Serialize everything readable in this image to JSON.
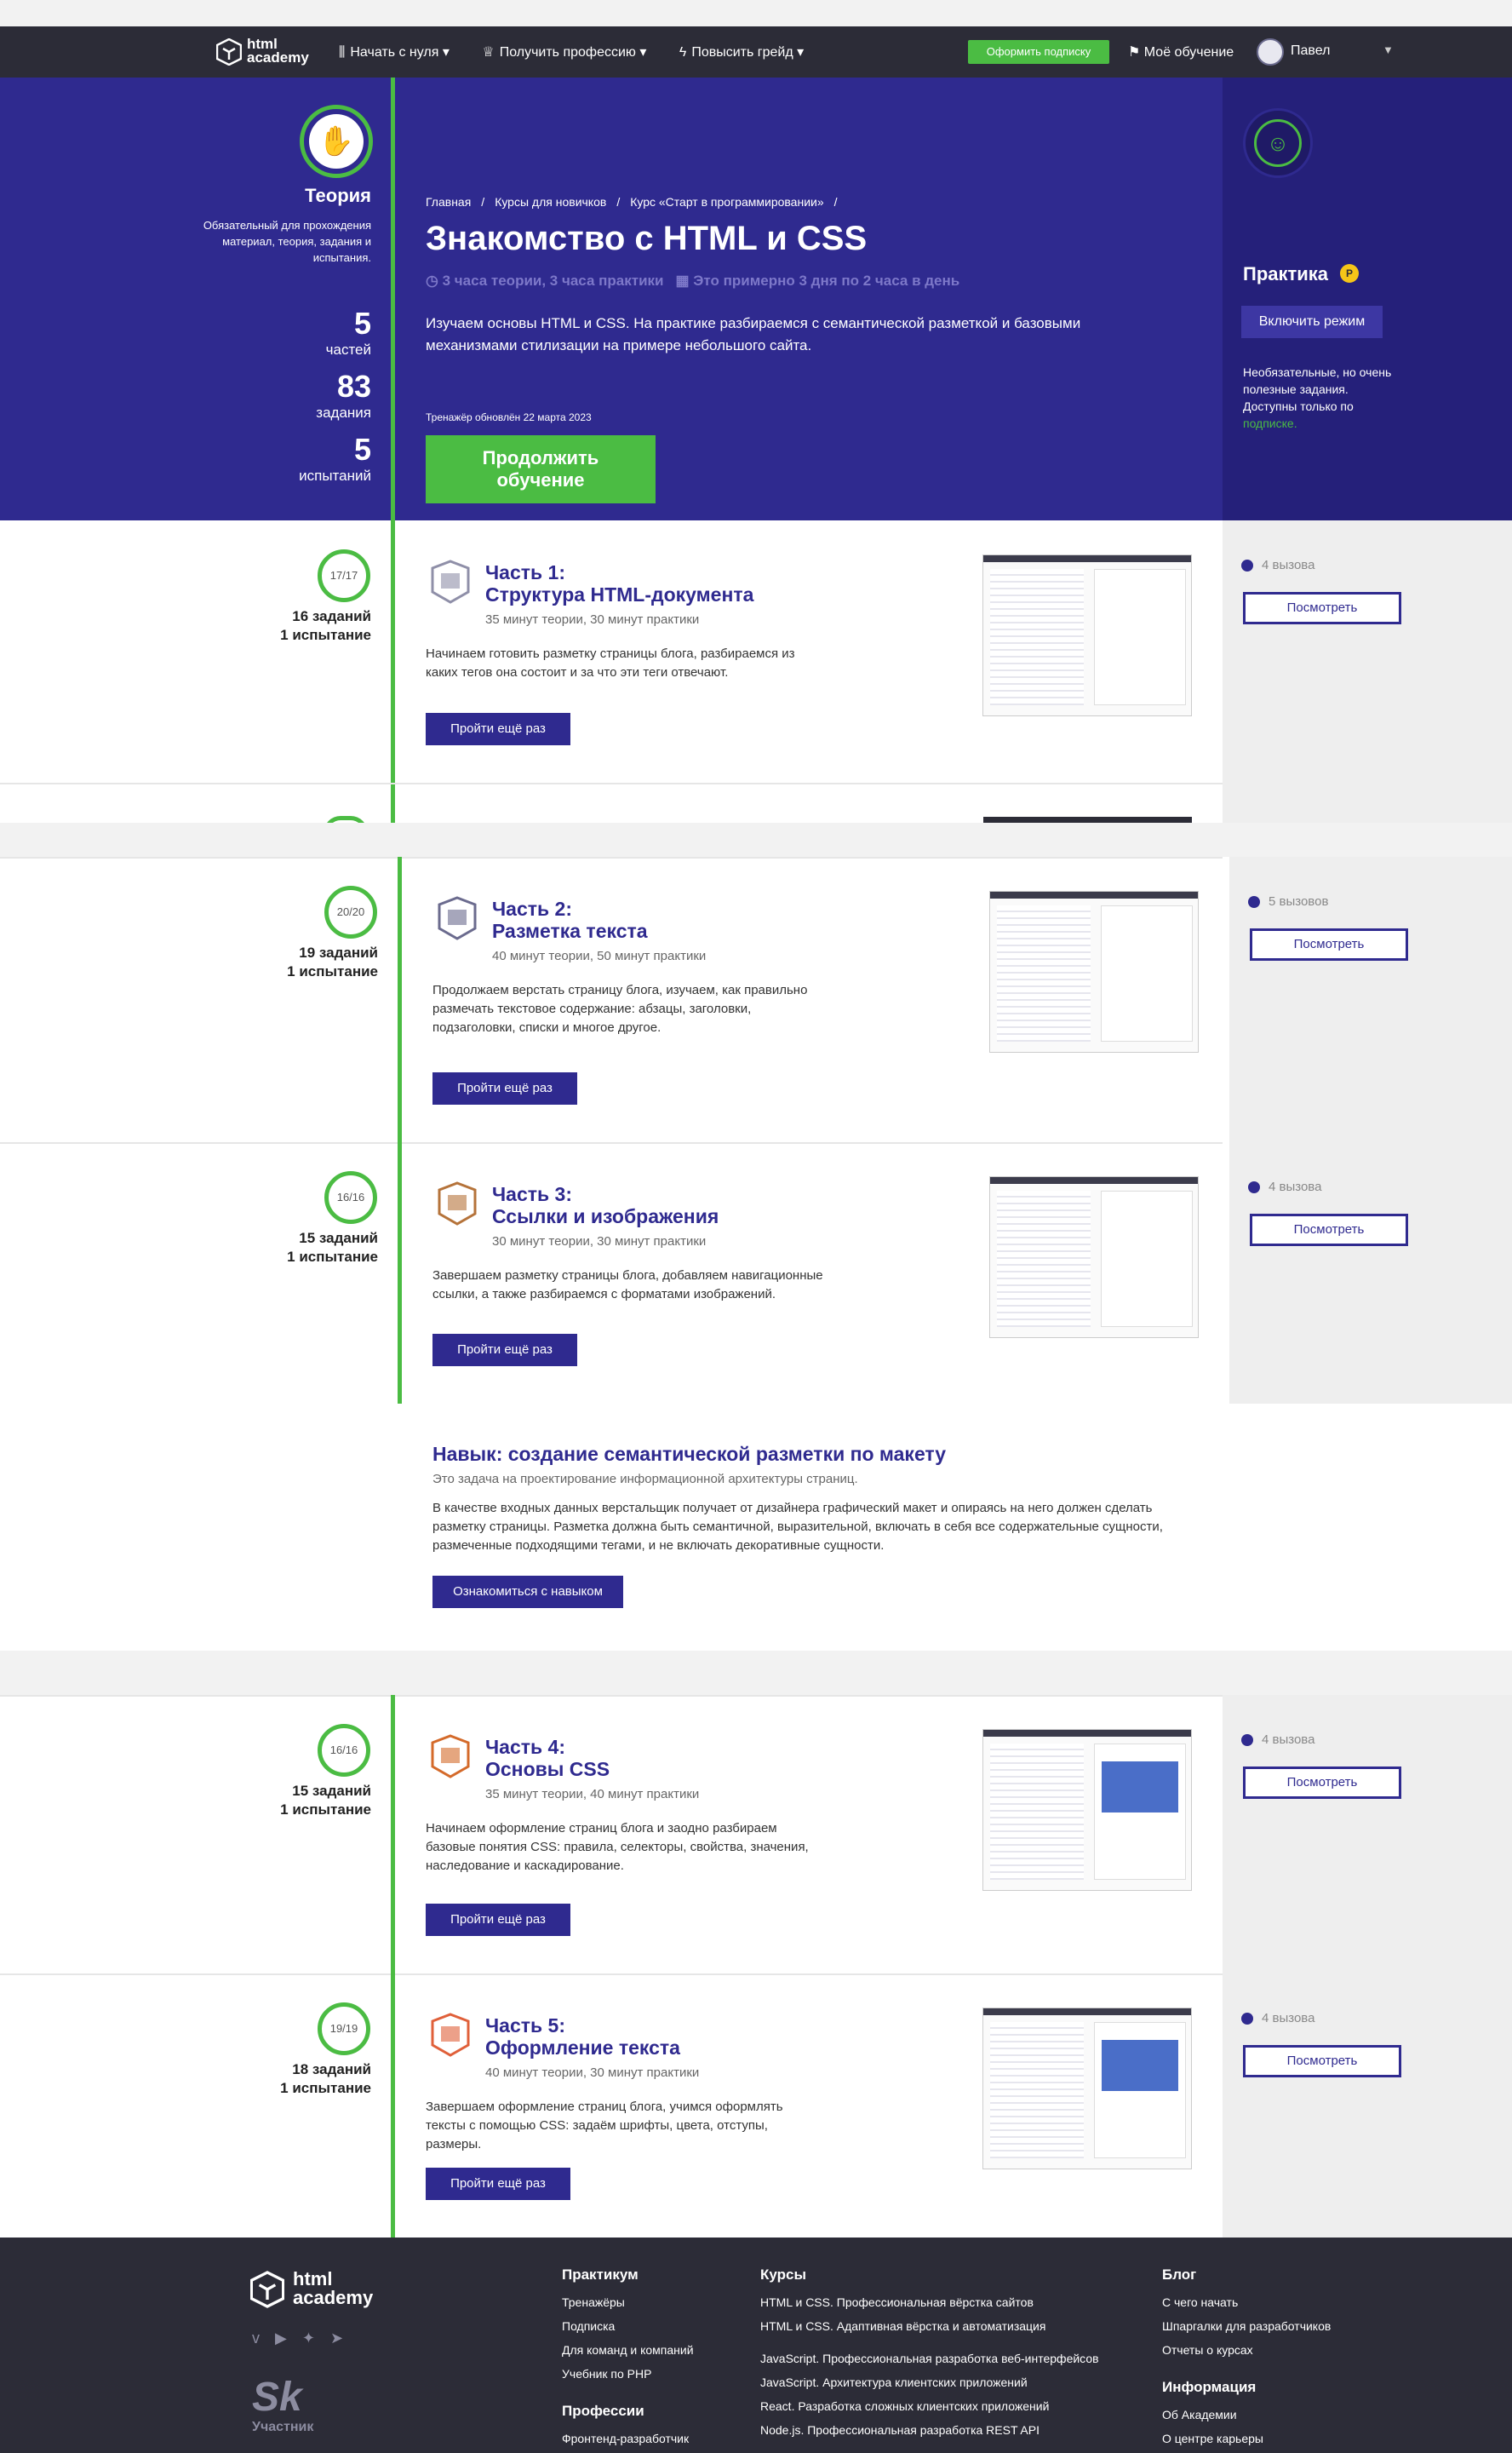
{
  "nav": {
    "logo": "html academy",
    "menu": [
      "Начать с нуля",
      "Получить профессию",
      "Повысить грейд"
    ],
    "subscribe": "Оформить подписку",
    "my": "Моё обучение",
    "user": "Павел"
  },
  "hero": {
    "theory": {
      "title": "Теория",
      "note": "Обязательный для прохождения материал, теория, задания и испытания.",
      "parts_num": "5",
      "parts_lbl": "частей",
      "tasks_num": "83",
      "tasks_lbl": "задания",
      "tests_num": "5",
      "tests_lbl": "испытаний"
    },
    "crumbs": [
      "Главная",
      "/",
      "Курсы для новичков",
      "/",
      "Курс «Старт в программировании»",
      "/"
    ],
    "title": "Знакомство с HTML и CSS",
    "meta1": "3 часа теории, 3 часа практики",
    "meta2": "Это примерно 3 дня по 2 часа в день",
    "intro": "Изучаем основы HTML и CSS. На практике разбираемся с семантической разметкой и базовыми механизмами стилизации на примере небольшого сайта.",
    "updated": "Тренажёр обновлён 22 марта 2023",
    "continue": "Продолжить обучение",
    "practice": {
      "title": "Практика",
      "badge": "P",
      "btn": "Включить режим",
      "note": "Необязательные, но очень полезные задания. Доступны только по ",
      "note_link": "подписке."
    }
  },
  "parts": [
    {
      "ring": "17/17",
      "s1": "16 заданий",
      "s2": "1 испытание",
      "t1": "Часть 1:",
      "t2": "Структура HTML-документа",
      "meta": "35 минут теории, 30 минут практики",
      "desc": "Начинаем готовить разметку страницы блога, разбираемся из каких тегов она состоит и за что эти теги отвечают.",
      "btn": "Пройти ещё раз",
      "calls": "4 вызова",
      "look": "Посмотреть"
    },
    {
      "ring": "20/20",
      "s1": "19 заданий",
      "s2": "1 испытание",
      "t1": "Часть 2:",
      "t2": "Разметка текста",
      "meta": "40 минут теории, 50 минут практики",
      "desc": "Продолжаем верстать страницу блога, изучаем, как правильно размечать текстовое содержание: абзацы, заголовки, подзаголовки, списки и многое другое.",
      "btn": "Пройти ещё раз",
      "calls": "5 вызовов",
      "look": "Посмотреть"
    },
    {
      "ring": "16/16",
      "s1": "15 заданий",
      "s2": "1 испытание",
      "t1": "Часть 3:",
      "t2": "Ссылки и изображения",
      "meta": "30 минут теории, 30 минут практики",
      "desc": "Завершаем разметку страницы блога, добавляем навигационные ссылки, а также разбираемся с форматами изображений.",
      "btn": "Пройти ещё раз",
      "calls": "4 вызова",
      "look": "Посмотреть"
    },
    {
      "ring": "16/16",
      "s1": "15 заданий",
      "s2": "1 испытание",
      "t1": "Часть 4:",
      "t2": "Основы CSS",
      "meta": "35 минут теории, 40 минут практики",
      "desc": "Начинаем оформление страниц блога и заодно разбираем базовые понятия CSS: правила, селекторы, свойства, значения, наследование и каскадирование.",
      "btn": "Пройти ещё раз",
      "calls": "4 вызова",
      "look": "Посмотреть"
    },
    {
      "ring": "19/19",
      "s1": "18 заданий",
      "s2": "1 испытание",
      "t1": "Часть 5:",
      "t2": "Оформление текста",
      "meta": "40 минут теории, 30 минут практики",
      "desc": "Завершаем оформление страниц блога, учимся оформлять тексты с помощью CSS: задаём шрифты, цвета, отступы, размеры.",
      "btn": "Пройти ещё раз",
      "calls": "4 вызова",
      "look": "Посмотреть"
    }
  ],
  "skill": {
    "title": "Навык: создание семантической разметки по макету",
    "sub": "Это задача на проектирование информационной архитектуры страниц.",
    "desc": "В качестве входных данных верстальщик получает от дизайнера графический макет и опираясь на него должен сделать разметку страницы. Разметка должна быть семантичной, выразительной, включать в себя все содержательные сущности, размеченные подходящими тегами, и не включать декоративные сущности.",
    "btn": "Ознакомиться с навыком"
  },
  "footer": {
    "logo": "html academy",
    "sk": "Sk",
    "sk_lbl": "Участник",
    "practicum": {
      "h": "Практикум",
      "items": [
        "Тренажёры",
        "Подписка",
        "Для команд и компаний",
        "Учебник по PHP"
      ]
    },
    "profs": {
      "h": "Профессии",
      "items": [
        "Фронтенд-разработчик"
      ]
    },
    "courses": {
      "h": "Курсы",
      "items": [
        "HTML и CSS. Профессиональная вёрстка сайтов",
        "HTML и CSS. Адаптивная вёрстка и автоматизация",
        "JavaScript. Профессиональная разработка веб-интерфейсов",
        "JavaScript. Архитектура клиентских приложений",
        "React. Разработка сложных клиентских приложений",
        "Node.js. Профессиональная разработка REST API"
      ]
    },
    "blog": {
      "h": "Блог",
      "items": [
        "С чего начать",
        "Шпаргалки для разработчиков",
        "Отчеты о курсах"
      ]
    },
    "info": {
      "h": "Информация",
      "items": [
        "Об Академии",
        "О центре карьеры"
      ]
    }
  }
}
